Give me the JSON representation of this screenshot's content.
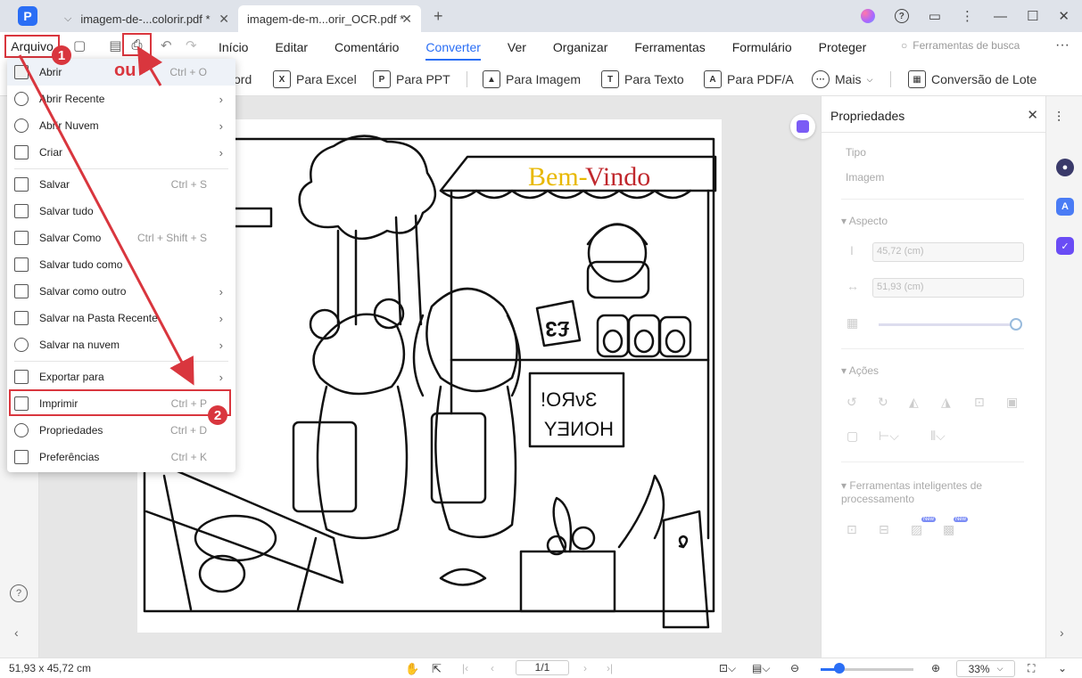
{
  "titlebar": {
    "tabs": [
      {
        "label": "imagem-de-...colorir.pdf *"
      },
      {
        "label": "imagem-de-m...orir_OCR.pdf *"
      }
    ]
  },
  "menubar": {
    "file_label": "Arquivo",
    "items": [
      "Início",
      "Editar",
      "Comentário",
      "Converter",
      "Ver",
      "Organizar",
      "Ferramentas",
      "Formulário",
      "Proteger"
    ],
    "active": "Converter",
    "search_placeholder": "Ferramentas de busca"
  },
  "toolbar": {
    "word_partial": "ord",
    "tools": [
      {
        "label": "Para Excel",
        "icon": "excel-icon"
      },
      {
        "label": "Para PPT",
        "icon": "ppt-icon"
      },
      {
        "label": "Para Imagem",
        "icon": "image-icon"
      },
      {
        "label": "Para Texto",
        "icon": "text-icon"
      },
      {
        "label": "Para PDF/A",
        "icon": "pdfa-icon"
      },
      {
        "label": "Mais",
        "icon": "more-icon"
      },
      {
        "label": "Conversão de Lote",
        "icon": "batch-icon"
      }
    ]
  },
  "file_menu": {
    "items": [
      {
        "label": "Abrir",
        "shortcut": "Ctrl + O",
        "submenu": false
      },
      {
        "label": "Abrir Recente",
        "shortcut": "",
        "submenu": true
      },
      {
        "label": "Abrir Nuvem",
        "shortcut": "",
        "submenu": true
      },
      {
        "label": "Criar",
        "shortcut": "",
        "submenu": true
      },
      {
        "label": "Salvar",
        "shortcut": "Ctrl + S",
        "submenu": false
      },
      {
        "label": "Salvar tudo",
        "shortcut": "",
        "submenu": false
      },
      {
        "label": "Salvar Como",
        "shortcut": "Ctrl + Shift + S",
        "submenu": false
      },
      {
        "label": "Salvar tudo como",
        "shortcut": "",
        "submenu": false
      },
      {
        "label": "Salvar como outro",
        "shortcut": "",
        "submenu": true
      },
      {
        "label": "Salvar na Pasta Recente",
        "shortcut": "",
        "submenu": true
      },
      {
        "label": "Salvar na nuvem",
        "shortcut": "",
        "submenu": true
      },
      {
        "label": "Exportar para",
        "shortcut": "",
        "submenu": true
      },
      {
        "label": "Imprimir",
        "shortcut": "Ctrl + P",
        "submenu": false
      },
      {
        "label": "Propriedades",
        "shortcut": "Ctrl + D",
        "submenu": false
      },
      {
        "label": "Preferências",
        "shortcut": "Ctrl + K",
        "submenu": false
      }
    ]
  },
  "annotations": {
    "badge1": "1",
    "badge2": "2",
    "ou": "ou",
    "color": "#d9363e"
  },
  "document": {
    "banner_part1": "Bem-",
    "banner_part2": "Vindo",
    "sign_price": "£3",
    "sign_honey_top": "!OЯνƐ",
    "sign_honey_bottom": "HONEY"
  },
  "properties": {
    "title": "Propriedades",
    "type_label": "Tipo",
    "type_value": "Imagem",
    "aspect_label": "Aspecto",
    "height_value": "45,72 (cm)",
    "width_value": "51,93 (cm)",
    "actions_label": "Ações",
    "smart_tools_label": "Ferramentas inteligentes de processamento",
    "new_badge": "New"
  },
  "statusbar": {
    "dimensions": "51,93 x 45,72 cm",
    "page": "1/1",
    "zoom": "33%",
    "zoom_level": 0.2
  },
  "colors": {
    "accent": "#2a6ef5",
    "annotation": "#d9363e",
    "banner_yellow": "#e8b800",
    "banner_red": "#c0282d"
  }
}
